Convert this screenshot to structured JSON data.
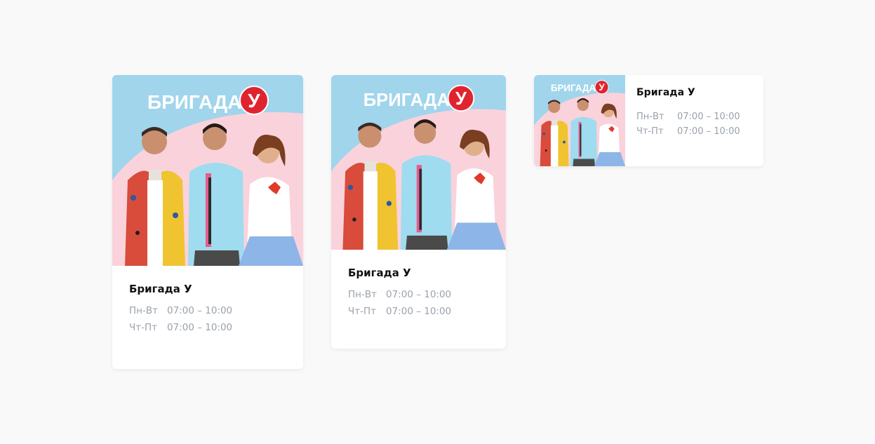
{
  "cards": [
    {
      "poster": {
        "logo": "БРИГАДА",
        "logo_badge": "У"
      },
      "title": "Бригада У",
      "schedule": [
        {
          "days": "Пн-Вт",
          "time": "07:00 – 10:00"
        },
        {
          "days": "Чт-Пт",
          "time": "07:00 – 10:00"
        }
      ]
    },
    {
      "poster": {
        "logo": "БРИГАДА",
        "logo_badge": "У"
      },
      "title": "Бригада У",
      "schedule": [
        {
          "days": "Пн-Вт",
          "time": "07:00 – 10:00"
        },
        {
          "days": "Чт-Пт",
          "time": "07:00 – 10:00"
        }
      ]
    },
    {
      "poster": {
        "logo": "БРИГАДА",
        "logo_badge": "У"
      },
      "title": "Бригада У",
      "schedule": [
        {
          "days": "Пн-Вт",
          "time": "07:00 – 10:00"
        },
        {
          "days": "Чт-Пт",
          "time": "07:00 – 10:00"
        }
      ]
    }
  ],
  "colors": {
    "page_bg": "#f9f9f9",
    "card_bg": "#ffffff",
    "poster_sky": "#a0d5ec",
    "poster_pink": "#fad2dc",
    "badge_red": "#e0242f",
    "title_text": "#111111",
    "schedule_text": "#9aa1ad"
  }
}
